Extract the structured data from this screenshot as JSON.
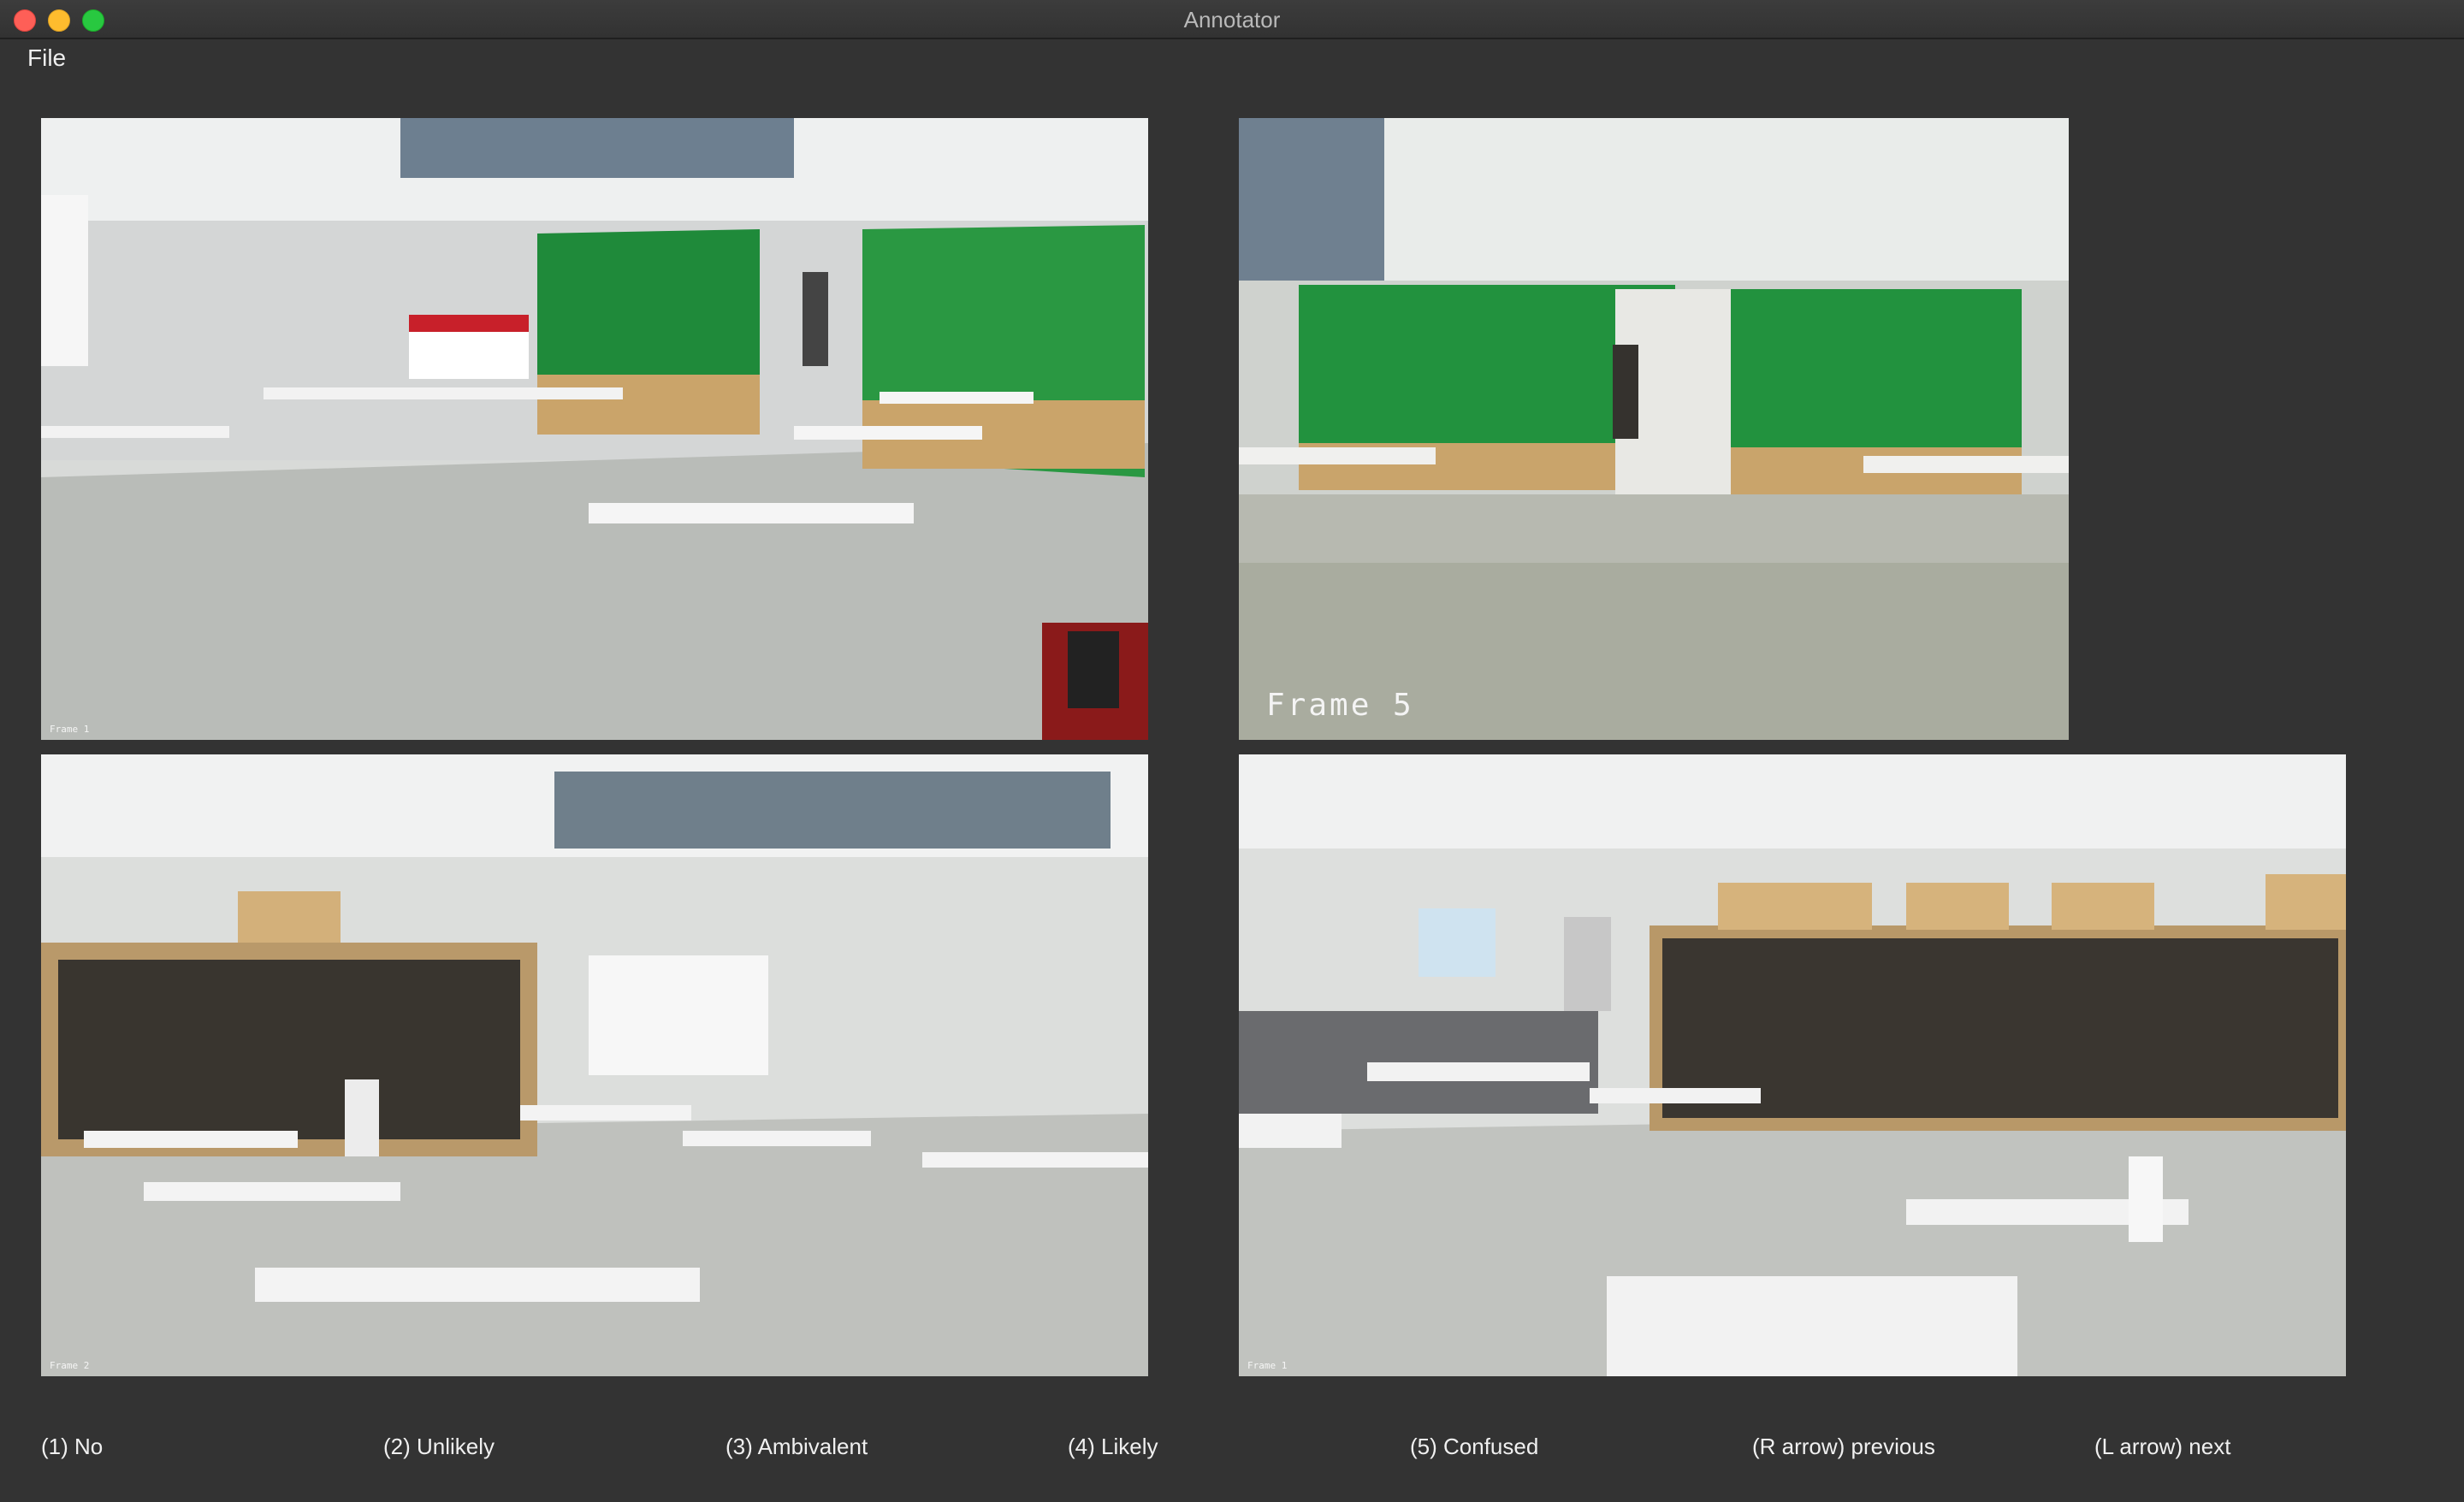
{
  "window": {
    "title": "Annotator",
    "controls": [
      "close",
      "minimize",
      "maximize"
    ]
  },
  "menu": {
    "file_label": "File"
  },
  "panels": [
    {
      "id": "camera-top-left",
      "overlay_label": "Frame 1",
      "description_icon": "lab-room-photo"
    },
    {
      "id": "camera-top-right",
      "overlay_label": "Frame 5",
      "description_icon": "lab-room-photo"
    },
    {
      "id": "camera-bottom-left",
      "overlay_label": "Frame 2",
      "description_icon": "lab-room-photo"
    },
    {
      "id": "camera-bottom-right",
      "overlay_label": "Frame 1",
      "description_icon": "lab-room-photo"
    }
  ],
  "key_hints": [
    "(1) No",
    "(2) Unlikely",
    "(3) Ambivalent",
    "(4) Likely",
    "(5) Confused",
    "(R arrow) previous",
    "(L arrow) next"
  ],
  "colors": {
    "window_bg": "#333333",
    "titlebar": "#3a3a3a",
    "text": "#f0f0f0",
    "green_screen": "#1f8a3a"
  }
}
